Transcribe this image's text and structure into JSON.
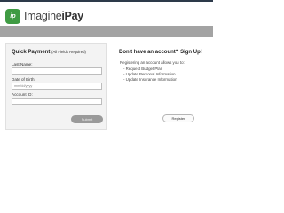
{
  "brand": {
    "badge_text": "ip",
    "name_prefix": "Imagine",
    "name_suffix": "iPay",
    "badge_color": "#3f9b43"
  },
  "quick_payment": {
    "title": "Quick Payment",
    "required_note": "(All Fields Required)",
    "fields": [
      {
        "label": "Last Name:",
        "value": "",
        "placeholder": ""
      },
      {
        "label": "Date of Birth:",
        "value": "",
        "placeholder": "mm/dd/yyyy"
      },
      {
        "label": "Account ID:",
        "value": "",
        "placeholder": ""
      }
    ],
    "submit_label": "Submit"
  },
  "signup": {
    "title": "Don't have an account? Sign Up!",
    "intro": "Registering an account allows you to:",
    "benefits": [
      "- Request Budget Plan",
      "- Update Personal Information",
      "- Update Insurance Information"
    ],
    "register_label": "Register"
  }
}
